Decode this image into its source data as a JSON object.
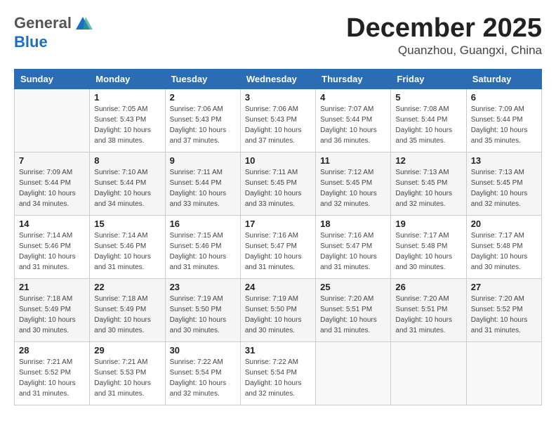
{
  "header": {
    "logo_line1": "General",
    "logo_line2": "Blue",
    "month": "December 2025",
    "location": "Quanzhou, Guangxi, China"
  },
  "weekdays": [
    "Sunday",
    "Monday",
    "Tuesday",
    "Wednesday",
    "Thursday",
    "Friday",
    "Saturday"
  ],
  "weeks": [
    [
      {
        "day": "",
        "sunrise": "",
        "sunset": "",
        "daylight": ""
      },
      {
        "day": "1",
        "sunrise": "7:05 AM",
        "sunset": "5:43 PM",
        "daylight": "10 hours and 38 minutes."
      },
      {
        "day": "2",
        "sunrise": "7:06 AM",
        "sunset": "5:43 PM",
        "daylight": "10 hours and 37 minutes."
      },
      {
        "day": "3",
        "sunrise": "7:06 AM",
        "sunset": "5:43 PM",
        "daylight": "10 hours and 37 minutes."
      },
      {
        "day": "4",
        "sunrise": "7:07 AM",
        "sunset": "5:44 PM",
        "daylight": "10 hours and 36 minutes."
      },
      {
        "day": "5",
        "sunrise": "7:08 AM",
        "sunset": "5:44 PM",
        "daylight": "10 hours and 35 minutes."
      },
      {
        "day": "6",
        "sunrise": "7:09 AM",
        "sunset": "5:44 PM",
        "daylight": "10 hours and 35 minutes."
      }
    ],
    [
      {
        "day": "7",
        "sunrise": "7:09 AM",
        "sunset": "5:44 PM",
        "daylight": "10 hours and 34 minutes."
      },
      {
        "day": "8",
        "sunrise": "7:10 AM",
        "sunset": "5:44 PM",
        "daylight": "10 hours and 34 minutes."
      },
      {
        "day": "9",
        "sunrise": "7:11 AM",
        "sunset": "5:44 PM",
        "daylight": "10 hours and 33 minutes."
      },
      {
        "day": "10",
        "sunrise": "7:11 AM",
        "sunset": "5:45 PM",
        "daylight": "10 hours and 33 minutes."
      },
      {
        "day": "11",
        "sunrise": "7:12 AM",
        "sunset": "5:45 PM",
        "daylight": "10 hours and 32 minutes."
      },
      {
        "day": "12",
        "sunrise": "7:13 AM",
        "sunset": "5:45 PM",
        "daylight": "10 hours and 32 minutes."
      },
      {
        "day": "13",
        "sunrise": "7:13 AM",
        "sunset": "5:45 PM",
        "daylight": "10 hours and 32 minutes."
      }
    ],
    [
      {
        "day": "14",
        "sunrise": "7:14 AM",
        "sunset": "5:46 PM",
        "daylight": "10 hours and 31 minutes."
      },
      {
        "day": "15",
        "sunrise": "7:14 AM",
        "sunset": "5:46 PM",
        "daylight": "10 hours and 31 minutes."
      },
      {
        "day": "16",
        "sunrise": "7:15 AM",
        "sunset": "5:46 PM",
        "daylight": "10 hours and 31 minutes."
      },
      {
        "day": "17",
        "sunrise": "7:16 AM",
        "sunset": "5:47 PM",
        "daylight": "10 hours and 31 minutes."
      },
      {
        "day": "18",
        "sunrise": "7:16 AM",
        "sunset": "5:47 PM",
        "daylight": "10 hours and 31 minutes."
      },
      {
        "day": "19",
        "sunrise": "7:17 AM",
        "sunset": "5:48 PM",
        "daylight": "10 hours and 30 minutes."
      },
      {
        "day": "20",
        "sunrise": "7:17 AM",
        "sunset": "5:48 PM",
        "daylight": "10 hours and 30 minutes."
      }
    ],
    [
      {
        "day": "21",
        "sunrise": "7:18 AM",
        "sunset": "5:49 PM",
        "daylight": "10 hours and 30 minutes."
      },
      {
        "day": "22",
        "sunrise": "7:18 AM",
        "sunset": "5:49 PM",
        "daylight": "10 hours and 30 minutes."
      },
      {
        "day": "23",
        "sunrise": "7:19 AM",
        "sunset": "5:50 PM",
        "daylight": "10 hours and 30 minutes."
      },
      {
        "day": "24",
        "sunrise": "7:19 AM",
        "sunset": "5:50 PM",
        "daylight": "10 hours and 30 minutes."
      },
      {
        "day": "25",
        "sunrise": "7:20 AM",
        "sunset": "5:51 PM",
        "daylight": "10 hours and 31 minutes."
      },
      {
        "day": "26",
        "sunrise": "7:20 AM",
        "sunset": "5:51 PM",
        "daylight": "10 hours and 31 minutes."
      },
      {
        "day": "27",
        "sunrise": "7:20 AM",
        "sunset": "5:52 PM",
        "daylight": "10 hours and 31 minutes."
      }
    ],
    [
      {
        "day": "28",
        "sunrise": "7:21 AM",
        "sunset": "5:52 PM",
        "daylight": "10 hours and 31 minutes."
      },
      {
        "day": "29",
        "sunrise": "7:21 AM",
        "sunset": "5:53 PM",
        "daylight": "10 hours and 31 minutes."
      },
      {
        "day": "30",
        "sunrise": "7:22 AM",
        "sunset": "5:54 PM",
        "daylight": "10 hours and 32 minutes."
      },
      {
        "day": "31",
        "sunrise": "7:22 AM",
        "sunset": "5:54 PM",
        "daylight": "10 hours and 32 minutes."
      },
      {
        "day": "",
        "sunrise": "",
        "sunset": "",
        "daylight": ""
      },
      {
        "day": "",
        "sunrise": "",
        "sunset": "",
        "daylight": ""
      },
      {
        "day": "",
        "sunrise": "",
        "sunset": "",
        "daylight": ""
      }
    ]
  ]
}
